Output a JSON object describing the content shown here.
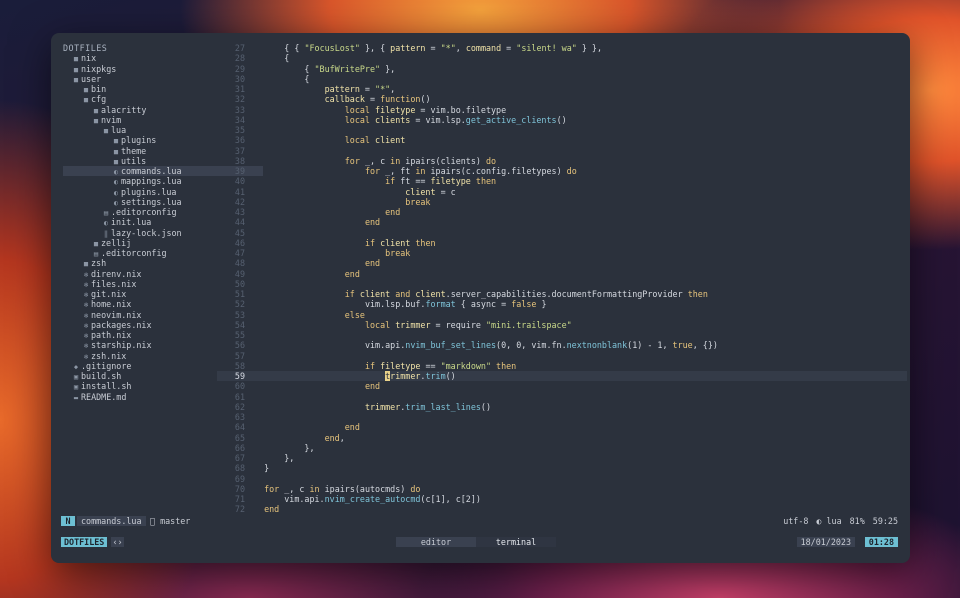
{
  "explorer": {
    "root": "DOTFILES",
    "items": [
      {
        "depth": 1,
        "icon": "folder",
        "name": "nix"
      },
      {
        "depth": 1,
        "icon": "folder",
        "name": "nixpkgs"
      },
      {
        "depth": 1,
        "icon": "folder",
        "name": "user"
      },
      {
        "depth": 2,
        "icon": "folder",
        "name": "bin"
      },
      {
        "depth": 2,
        "icon": "folder",
        "name": "cfg"
      },
      {
        "depth": 3,
        "icon": "folder",
        "name": "alacritty"
      },
      {
        "depth": 3,
        "icon": "folder",
        "name": "nvim"
      },
      {
        "depth": 4,
        "icon": "folder",
        "name": "lua"
      },
      {
        "depth": 5,
        "icon": "folder",
        "name": "plugins"
      },
      {
        "depth": 5,
        "icon": "folder",
        "name": "theme"
      },
      {
        "depth": 5,
        "icon": "folder",
        "name": "utils"
      },
      {
        "depth": 5,
        "icon": "lua",
        "name": "commands.lua",
        "selected": true
      },
      {
        "depth": 5,
        "icon": "lua",
        "name": "mappings.lua"
      },
      {
        "depth": 5,
        "icon": "lua",
        "name": "plugins.lua"
      },
      {
        "depth": 5,
        "icon": "lua",
        "name": "settings.lua"
      },
      {
        "depth": 4,
        "icon": "file",
        "name": ".editorconfig"
      },
      {
        "depth": 4,
        "icon": "lua",
        "name": "init.lua"
      },
      {
        "depth": 4,
        "icon": "json",
        "name": "lazy-lock.json"
      },
      {
        "depth": 3,
        "icon": "folder",
        "name": "zellij"
      },
      {
        "depth": 3,
        "icon": "file",
        "name": ".editorconfig"
      },
      {
        "depth": 2,
        "icon": "folder",
        "name": "zsh"
      },
      {
        "depth": 2,
        "icon": "nix",
        "name": "direnv.nix"
      },
      {
        "depth": 2,
        "icon": "nix",
        "name": "files.nix"
      },
      {
        "depth": 2,
        "icon": "nix",
        "name": "git.nix"
      },
      {
        "depth": 2,
        "icon": "nix",
        "name": "home.nix"
      },
      {
        "depth": 2,
        "icon": "nix",
        "name": "neovim.nix"
      },
      {
        "depth": 2,
        "icon": "nix",
        "name": "packages.nix"
      },
      {
        "depth": 2,
        "icon": "nix",
        "name": "path.nix"
      },
      {
        "depth": 2,
        "icon": "nix",
        "name": "starship.nix"
      },
      {
        "depth": 2,
        "icon": "nix",
        "name": "zsh.nix"
      },
      {
        "depth": 1,
        "icon": "git",
        "name": ".gitignore"
      },
      {
        "depth": 1,
        "icon": "shell",
        "name": "build.sh"
      },
      {
        "depth": 1,
        "icon": "shell",
        "name": "install.sh"
      },
      {
        "depth": 1,
        "icon": "markdown",
        "name": "README.md"
      }
    ]
  },
  "editor": {
    "current_line": 59,
    "lines": [
      {
        "n": 27,
        "indent": 2,
        "tokens": [
          [
            "op",
            "{ { "
          ],
          [
            "str",
            "\"FocusLost\""
          ],
          [
            "op",
            " }, { "
          ],
          [
            "var",
            "pattern"
          ],
          [
            "op",
            " = "
          ],
          [
            "str",
            "\"*\""
          ],
          [
            "op",
            ", "
          ],
          [
            "var",
            "command"
          ],
          [
            "op",
            " = "
          ],
          [
            "str",
            "\"silent! wa\""
          ],
          [
            "op",
            " } },"
          ]
        ]
      },
      {
        "n": 28,
        "indent": 2,
        "tokens": [
          [
            "op",
            "{"
          ]
        ]
      },
      {
        "n": 29,
        "indent": 3,
        "tokens": [
          [
            "op",
            "{ "
          ],
          [
            "str",
            "\"BufWritePre\""
          ],
          [
            "op",
            " },"
          ]
        ]
      },
      {
        "n": 30,
        "indent": 3,
        "tokens": [
          [
            "op",
            "{"
          ]
        ]
      },
      {
        "n": 31,
        "indent": 4,
        "tokens": [
          [
            "var",
            "pattern"
          ],
          [
            "op",
            " = "
          ],
          [
            "str",
            "\"*\""
          ],
          [
            "op",
            ","
          ]
        ]
      },
      {
        "n": 32,
        "indent": 4,
        "tokens": [
          [
            "var",
            "callback"
          ],
          [
            "op",
            " = "
          ],
          [
            "kw",
            "function"
          ],
          [
            "op",
            "()"
          ]
        ]
      },
      {
        "n": 33,
        "indent": 5,
        "tokens": [
          [
            "kw",
            "local "
          ],
          [
            "var",
            "filetype"
          ],
          [
            "op",
            " = vim.bo.filetype"
          ]
        ]
      },
      {
        "n": 34,
        "indent": 5,
        "tokens": [
          [
            "kw",
            "local "
          ],
          [
            "var",
            "clients"
          ],
          [
            "op",
            " = vim.lsp."
          ],
          [
            "fn",
            "get_active_clients"
          ],
          [
            "op",
            "()"
          ]
        ]
      },
      {
        "n": 35,
        "indent": 0,
        "tokens": []
      },
      {
        "n": 36,
        "indent": 5,
        "tokens": [
          [
            "kw",
            "local "
          ],
          [
            "var",
            "client"
          ]
        ]
      },
      {
        "n": 37,
        "indent": 0,
        "tokens": []
      },
      {
        "n": 38,
        "indent": 5,
        "tokens": [
          [
            "kw",
            "for "
          ],
          [
            "op",
            "_, c "
          ],
          [
            "kw",
            "in "
          ],
          [
            "op",
            "ipairs(clients) "
          ],
          [
            "kw",
            "do"
          ]
        ]
      },
      {
        "n": 39,
        "indent": 6,
        "tokens": [
          [
            "kw",
            "for "
          ],
          [
            "op",
            "_, ft "
          ],
          [
            "kw",
            "in "
          ],
          [
            "op",
            "ipairs(c.config.filetypes) "
          ],
          [
            "kw",
            "do"
          ]
        ]
      },
      {
        "n": 40,
        "indent": 7,
        "tokens": [
          [
            "kw",
            "if "
          ],
          [
            "op",
            "ft == "
          ],
          [
            "var",
            "filetype"
          ],
          [
            "kw",
            " then"
          ]
        ]
      },
      {
        "n": 41,
        "indent": 8,
        "tokens": [
          [
            "var",
            "client"
          ],
          [
            "op",
            " = c"
          ]
        ]
      },
      {
        "n": 42,
        "indent": 8,
        "tokens": [
          [
            "kw",
            "break"
          ]
        ]
      },
      {
        "n": 43,
        "indent": 7,
        "tokens": [
          [
            "kw",
            "end"
          ]
        ]
      },
      {
        "n": 44,
        "indent": 6,
        "tokens": [
          [
            "kw",
            "end"
          ]
        ]
      },
      {
        "n": 45,
        "indent": 0,
        "tokens": []
      },
      {
        "n": 46,
        "indent": 6,
        "tokens": [
          [
            "kw",
            "if "
          ],
          [
            "var",
            "client"
          ],
          [
            "kw",
            " then"
          ]
        ]
      },
      {
        "n": 47,
        "indent": 7,
        "tokens": [
          [
            "kw",
            "break"
          ]
        ]
      },
      {
        "n": 48,
        "indent": 6,
        "tokens": [
          [
            "kw",
            "end"
          ]
        ]
      },
      {
        "n": 49,
        "indent": 5,
        "tokens": [
          [
            "kw",
            "end"
          ]
        ]
      },
      {
        "n": 50,
        "indent": 0,
        "tokens": []
      },
      {
        "n": 51,
        "indent": 5,
        "tokens": [
          [
            "kw",
            "if "
          ],
          [
            "var",
            "client"
          ],
          [
            "kw",
            " and "
          ],
          [
            "var",
            "client"
          ],
          [
            "op",
            ".server_capabilities.documentFormattingProvider "
          ],
          [
            "kw",
            "then"
          ]
        ]
      },
      {
        "n": 52,
        "indent": 6,
        "tokens": [
          [
            "op",
            "vim.lsp.buf."
          ],
          [
            "fn",
            "format"
          ],
          [
            "op",
            " { async = "
          ],
          [
            "kw",
            "false"
          ],
          [
            "op",
            " }"
          ]
        ]
      },
      {
        "n": 53,
        "indent": 5,
        "tokens": [
          [
            "kw",
            "else"
          ]
        ]
      },
      {
        "n": 54,
        "indent": 6,
        "tokens": [
          [
            "kw",
            "local "
          ],
          [
            "var",
            "trimmer"
          ],
          [
            "op",
            " = require "
          ],
          [
            "str",
            "\"mini.trailspace\""
          ]
        ]
      },
      {
        "n": 55,
        "indent": 0,
        "tokens": []
      },
      {
        "n": 56,
        "indent": 6,
        "tokens": [
          [
            "op",
            "vim.api."
          ],
          [
            "fn",
            "nvim_buf_set_lines"
          ],
          [
            "op",
            "(0, 0, vim.fn."
          ],
          [
            "fn",
            "nextnonblank"
          ],
          [
            "op",
            "(1) - 1, "
          ],
          [
            "kw",
            "true"
          ],
          [
            "op",
            ", {})"
          ]
        ]
      },
      {
        "n": 57,
        "indent": 0,
        "tokens": []
      },
      {
        "n": 58,
        "indent": 6,
        "tokens": [
          [
            "kw",
            "if "
          ],
          [
            "var",
            "filetype"
          ],
          [
            "op",
            " == "
          ],
          [
            "str",
            "\"markdown\""
          ],
          [
            "kw",
            " then"
          ]
        ]
      },
      {
        "n": 59,
        "indent": 7,
        "tokens": [
          [
            "cursor",
            "t"
          ],
          [
            "var",
            "rimmer"
          ],
          [
            "op",
            "."
          ],
          [
            "fn",
            "trim"
          ],
          [
            "op",
            "()"
          ]
        ]
      },
      {
        "n": 60,
        "indent": 6,
        "tokens": [
          [
            "kw",
            "end"
          ]
        ]
      },
      {
        "n": 61,
        "indent": 0,
        "tokens": []
      },
      {
        "n": 62,
        "indent": 6,
        "tokens": [
          [
            "var",
            "trimmer"
          ],
          [
            "op",
            "."
          ],
          [
            "fn",
            "trim_last_lines"
          ],
          [
            "op",
            "()"
          ]
        ]
      },
      {
        "n": 63,
        "indent": 0,
        "tokens": []
      },
      {
        "n": 64,
        "indent": 5,
        "tokens": [
          [
            "kw",
            "end"
          ]
        ]
      },
      {
        "n": 65,
        "indent": 4,
        "tokens": [
          [
            "kw",
            "end"
          ],
          [
            "op",
            ","
          ]
        ]
      },
      {
        "n": 66,
        "indent": 3,
        "tokens": [
          [
            "op",
            "},"
          ]
        ]
      },
      {
        "n": 67,
        "indent": 2,
        "tokens": [
          [
            "op",
            "},"
          ]
        ]
      },
      {
        "n": 68,
        "indent": 1,
        "tokens": [
          [
            "op",
            "}"
          ]
        ]
      },
      {
        "n": 69,
        "indent": 0,
        "tokens": []
      },
      {
        "n": 70,
        "indent": 1,
        "tokens": [
          [
            "kw",
            "for "
          ],
          [
            "op",
            "_, c "
          ],
          [
            "kw",
            "in "
          ],
          [
            "op",
            "ipairs(autocmds) "
          ],
          [
            "kw",
            "do"
          ]
        ]
      },
      {
        "n": 71,
        "indent": 2,
        "tokens": [
          [
            "op",
            "vim.api."
          ],
          [
            "fn",
            "nvim_create_autocmd"
          ],
          [
            "op",
            "(c[1], c[2])"
          ]
        ]
      },
      {
        "n": 72,
        "indent": 1,
        "tokens": [
          [
            "kw",
            "end"
          ]
        ]
      }
    ]
  },
  "statusline": {
    "mode": "N",
    "file": "commands.lua",
    "branch": " master",
    "encoding": "utf-8",
    "filetype": "◐ lua",
    "percent": "81%",
    "position": "59:25"
  },
  "tabbar": {
    "session": "DOTFILES",
    "session_arrow": "‹›",
    "tabs": [
      "editor",
      "terminal"
    ],
    "date": "18/01/2023",
    "time": "01:28"
  },
  "colors": {
    "background": "#2b313c",
    "accent": "#6dbfd3",
    "keyword": "#e7c47c",
    "string": "#c9d98a",
    "function": "#7fc4d9"
  }
}
